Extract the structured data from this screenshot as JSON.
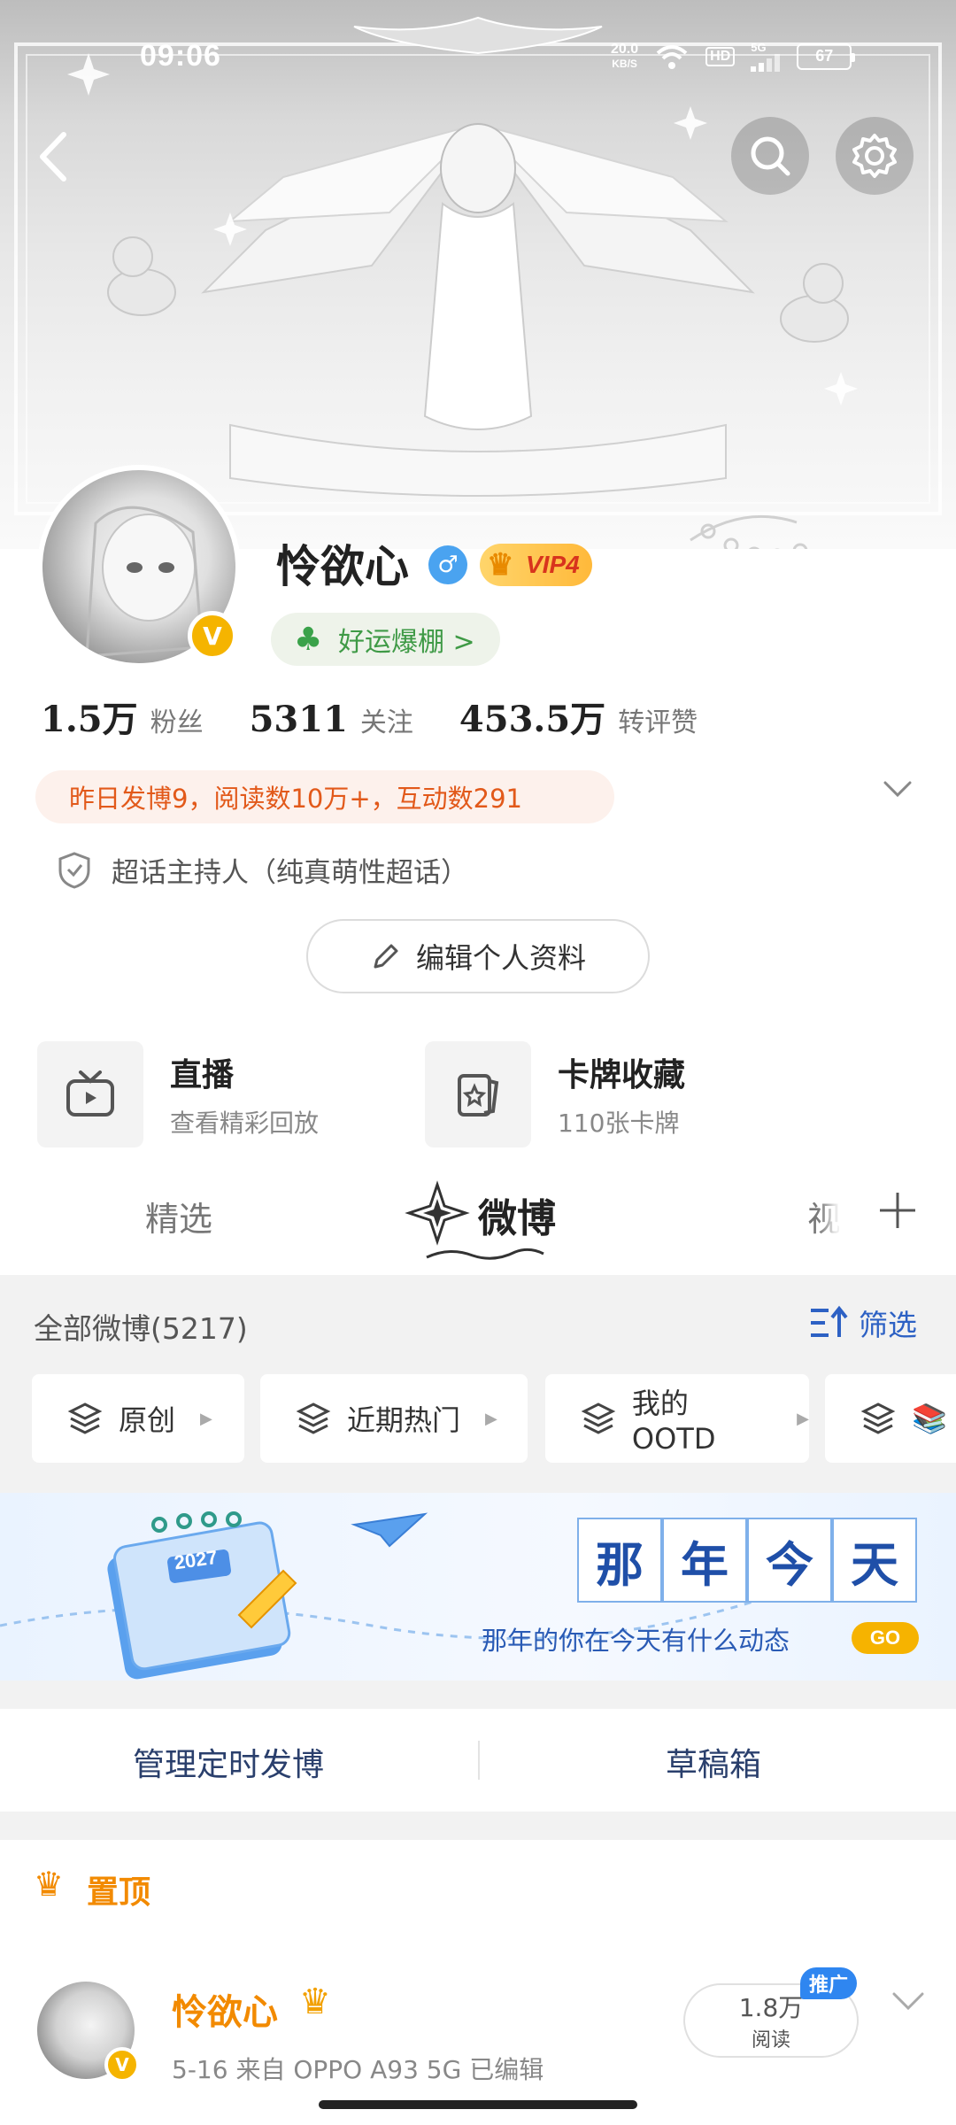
{
  "status_bar": {
    "time": "09:06",
    "net_speed_value": "20.0",
    "net_speed_unit": "KB/S",
    "hd": "HD",
    "signal": "5G",
    "battery": "67"
  },
  "profile": {
    "name": "怜欲心",
    "vip": "VIP4",
    "luck_tag": "好运爆棚 >",
    "stats": [
      {
        "value": "1.5万",
        "label": "粉丝"
      },
      {
        "value": "5311",
        "label": "关注"
      },
      {
        "value": "453.5万",
        "label": "转评赞"
      }
    ],
    "yesterday_summary": "昨日发博9，阅读数10万+，互动数291",
    "host_role": "超话主持人（纯真萌性超话）",
    "edit_button": "编辑个人资料"
  },
  "features": [
    {
      "title": "直播",
      "subtitle": "查看精彩回放",
      "icon": "tv-icon"
    },
    {
      "title": "卡牌收藏",
      "subtitle": "110张卡牌",
      "icon": "card-icon"
    }
  ],
  "tabs": {
    "featured": "精选",
    "weibo": "微博",
    "video": "视"
  },
  "feed_filter": {
    "all_label": "全部微博(5217)",
    "filter_label": "筛选",
    "chips": [
      "原创",
      "近期热门",
      "我的OOTD",
      "📚"
    ]
  },
  "banner": {
    "year": "2027",
    "title_chars": [
      "那",
      "年",
      "今",
      "天"
    ],
    "subtitle": "那年的你在今天有什么动态",
    "go": "GO"
  },
  "actions": {
    "scheduled": "管理定时发博",
    "drafts": "草稿箱"
  },
  "pinned": {
    "label": "置顶",
    "author": "怜欲心",
    "meta": "5-16  来自 OPPO A93 5G  已编辑",
    "views_value": "1.8万",
    "views_label": "阅读",
    "promo_badge": "推广"
  }
}
